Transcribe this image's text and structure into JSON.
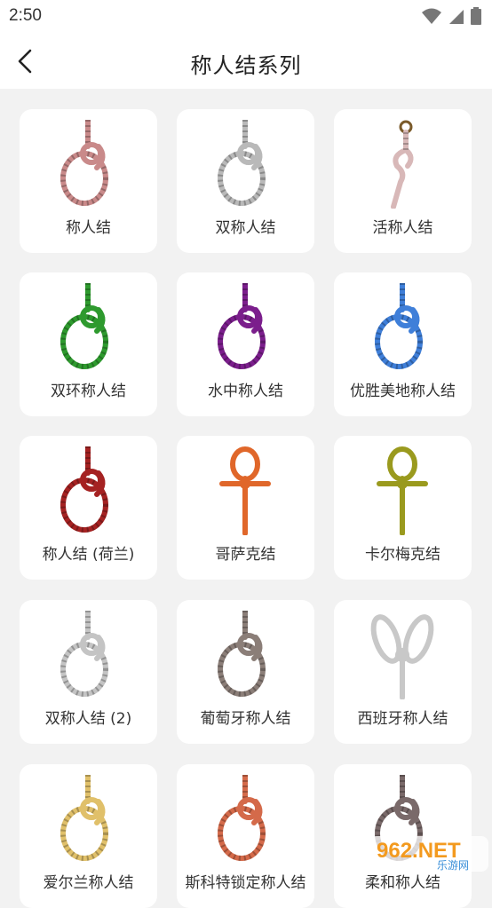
{
  "status_bar": {
    "time": "2:50"
  },
  "header": {
    "title": "称人结系列"
  },
  "knots": [
    {
      "name": "称人结",
      "color": "#c98a8a",
      "style": "bowline"
    },
    {
      "name": "双称人结",
      "color": "#b9b9b9",
      "style": "bowline"
    },
    {
      "name": "活称人结",
      "color": "#d8b8b8",
      "style": "running"
    },
    {
      "name": "双环称人结",
      "color": "#2e9a2e",
      "style": "bowline"
    },
    {
      "name": "水中称人结",
      "color": "#7b1e8c",
      "style": "bowline"
    },
    {
      "name": "优胜美地称人结",
      "color": "#3f7fd9",
      "style": "bowline"
    },
    {
      "name": "称人结 (荷兰)",
      "color": "#a52222",
      "style": "bowline"
    },
    {
      "name": "哥萨克结",
      "color": "#e0672a",
      "style": "cossack"
    },
    {
      "name": "卡尔梅克结",
      "color": "#9a9a1e",
      "style": "cossack"
    },
    {
      "name": "双称人结 (2)",
      "color": "#c4c4c4",
      "style": "bowline"
    },
    {
      "name": "葡萄牙称人结",
      "color": "#8b7e78",
      "style": "bowline"
    },
    {
      "name": "西班牙称人结",
      "color": "#c8c8c8",
      "style": "spanish"
    },
    {
      "name": "爱尔兰称人结",
      "color": "#e0c06a",
      "style": "bowline"
    },
    {
      "name": "斯科特锁定称人结",
      "color": "#d46a4a",
      "style": "bowline"
    },
    {
      "name": "柔和称人结",
      "color": "#7a6a6a",
      "style": "bowline"
    }
  ],
  "watermark": {
    "text": "962.NET",
    "subtext": "乐游网"
  }
}
